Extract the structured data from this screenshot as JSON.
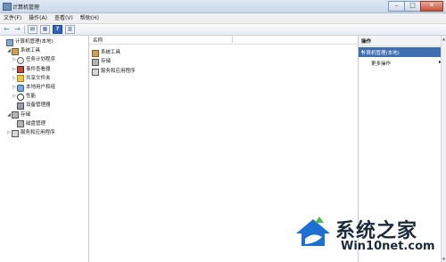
{
  "window": {
    "title": "计算机管理"
  },
  "menu": [
    "文件(F)",
    "操作(A)",
    "查看(V)",
    "帮助(H)"
  ],
  "toolbar": {
    "back": "←",
    "forward": "→",
    "help": "?"
  },
  "tree": [
    {
      "label": "计算机管理(本地)",
      "level": 0,
      "icon": "computer-icon",
      "expander": ""
    },
    {
      "label": "系统工具",
      "level": 1,
      "icon": "tools-icon",
      "expander": "◢"
    },
    {
      "label": "任务计划程序",
      "level": 2,
      "icon": "clock-icon",
      "expander": "▷"
    },
    {
      "label": "事件查看器",
      "level": 2,
      "icon": "event-icon",
      "expander": "▷"
    },
    {
      "label": "共享文件夹",
      "level": 2,
      "icon": "folder-icon",
      "expander": "▷"
    },
    {
      "label": "本地用户和组",
      "level": 2,
      "icon": "users-icon",
      "expander": "▷"
    },
    {
      "label": "性能",
      "level": 2,
      "icon": "performance-icon",
      "expander": "▷"
    },
    {
      "label": "设备管理器",
      "level": 2,
      "icon": "device-icon",
      "expander": ""
    },
    {
      "label": "存储",
      "level": 1,
      "icon": "storage-icon",
      "expander": "◢"
    },
    {
      "label": "磁盘管理",
      "level": 2,
      "icon": "disk-icon",
      "expander": ""
    },
    {
      "label": "服务和应用程序",
      "level": 1,
      "icon": "services-icon",
      "expander": "▷"
    }
  ],
  "list": {
    "header": "名称",
    "items": [
      "系统工具",
      "存储",
      "服务和应用程序"
    ]
  },
  "actions": {
    "header": "操作",
    "section": "计算机管理(本地)",
    "item": "更多操作"
  },
  "watermark": {
    "brand": "系统之家",
    "url": "Win10net.com"
  }
}
